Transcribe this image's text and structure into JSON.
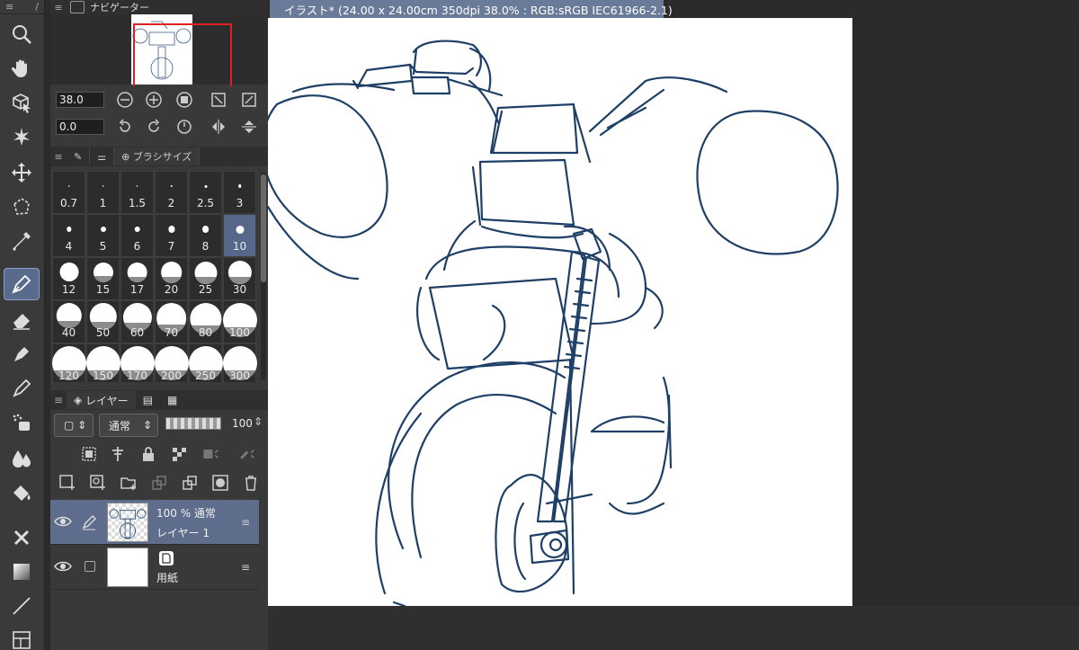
{
  "navigator": {
    "title": "ナビゲーター",
    "zoom": "38.0",
    "rotation": "0.0"
  },
  "brush_panel": {
    "tab_label": "ブラシサイズ",
    "sizes": [
      "0.7",
      "1",
      "1.5",
      "2",
      "2.5",
      "3",
      "4",
      "5",
      "6",
      "7",
      "8",
      "10",
      "12",
      "15",
      "17",
      "20",
      "25",
      "30",
      "40",
      "50",
      "60",
      "70",
      "80",
      "100",
      "120",
      "150",
      "170",
      "200",
      "250",
      "300"
    ],
    "selected": "10"
  },
  "layer_panel": {
    "tab_label": "レイヤー",
    "blend_mode": "通常",
    "opacity": "100",
    "layers": [
      {
        "line1": "100 % 通常",
        "line2": "レイヤー 1",
        "selected": true
      },
      {
        "line1": "",
        "line2": "用紙",
        "selected": false
      }
    ]
  },
  "document": {
    "tab_title": "イラスト* (24.00 x 24.00cm 350dpi 38.0% : RGB:sRGB IEC61966-2.1)"
  },
  "colors": {
    "accent": "#56678a",
    "stroke": "#1e3f66",
    "paper": "#ffffff"
  },
  "icons": [
    "zoom-icon",
    "hand-icon",
    "object-select-icon",
    "auto-select-icon",
    "move-icon",
    "selection-icon",
    "eyedropper-icon",
    "pen-icon",
    "eraser-icon",
    "fill-pen-icon",
    "marker-icon",
    "airbrush-icon",
    "blend-icon",
    "fill-icon",
    "figure-icon",
    "gradient-icon",
    "line-icon",
    "frame-icon"
  ]
}
